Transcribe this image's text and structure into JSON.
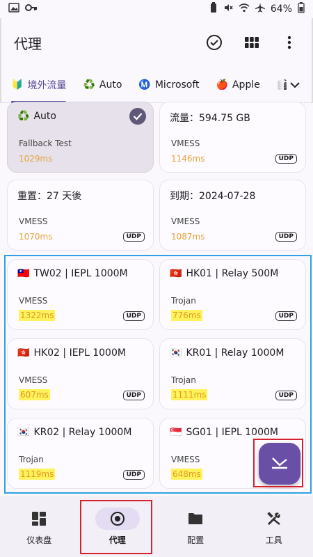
{
  "status": {
    "battery": "64%"
  },
  "appbar": {
    "title": "代理"
  },
  "tabs": [
    {
      "label": "境外流量",
      "icon": "🔰",
      "active": true
    },
    {
      "label": "Auto",
      "icon": "♻️"
    },
    {
      "label": "Microsoft",
      "icon": "Ⓜ️"
    },
    {
      "label": "Apple",
      "icon": "🍎"
    },
    {
      "label": "Y",
      "icon": "🎬"
    }
  ],
  "cards": {
    "c0": {
      "name": "Auto",
      "flag": "♻️",
      "type": "Fallback Test",
      "latency": "1029ms"
    },
    "c1": {
      "name": "流量：594.75 GB",
      "type": "VMESS",
      "latency": "1146ms",
      "udp": "UDP"
    },
    "c2": {
      "name": "重置：27 天後",
      "type": "VMESS",
      "latency": "1070ms",
      "udp": "UDP"
    },
    "c3": {
      "name": "到期：2024-07-28",
      "type": "VMESS",
      "latency": "1087ms",
      "udp": "UDP"
    },
    "c4": {
      "name": "TW02 | IEPL 1000M",
      "flag": "🇹🇼",
      "type": "VMESS",
      "latency": "1322ms",
      "udp": "UDP"
    },
    "c5": {
      "name": "HK01 | Relay 500M",
      "flag": "🇭🇰",
      "type": "Trojan",
      "latency": "776ms",
      "udp": "UDP"
    },
    "c6": {
      "name": "HK02 | IEPL 1000M",
      "flag": "🇭🇰",
      "type": "VMESS",
      "latency": "607ms",
      "udp": "UDP"
    },
    "c7": {
      "name": "KR01 | Relay 1000M",
      "flag": "🇰🇷",
      "type": "Trojan",
      "latency": "1111ms",
      "udp": "UDP"
    },
    "c8": {
      "name": "KR02 | Relay 1000M",
      "flag": "🇰🇷",
      "type": "Trojan",
      "latency": "1119ms",
      "udp": "UDP"
    },
    "c9": {
      "name": "SG01 | IEPL 1000M",
      "flag": "🇸🇬",
      "type": "VMESS",
      "latency": "648ms",
      "udp": "UDP"
    }
  },
  "nav": [
    {
      "label": "仪表盘",
      "icon": "dashboard-icon"
    },
    {
      "label": "代理",
      "icon": "proxy-icon",
      "active": true
    },
    {
      "label": "配置",
      "icon": "folder-icon"
    },
    {
      "label": "工具",
      "icon": "tools-icon"
    }
  ],
  "colors": {
    "accent": "#6a4fa6",
    "latency": "#e6a23c",
    "highlight": "#fff25a",
    "annotation_red": "#d6222e",
    "annotation_blue": "#2fa1e6"
  }
}
